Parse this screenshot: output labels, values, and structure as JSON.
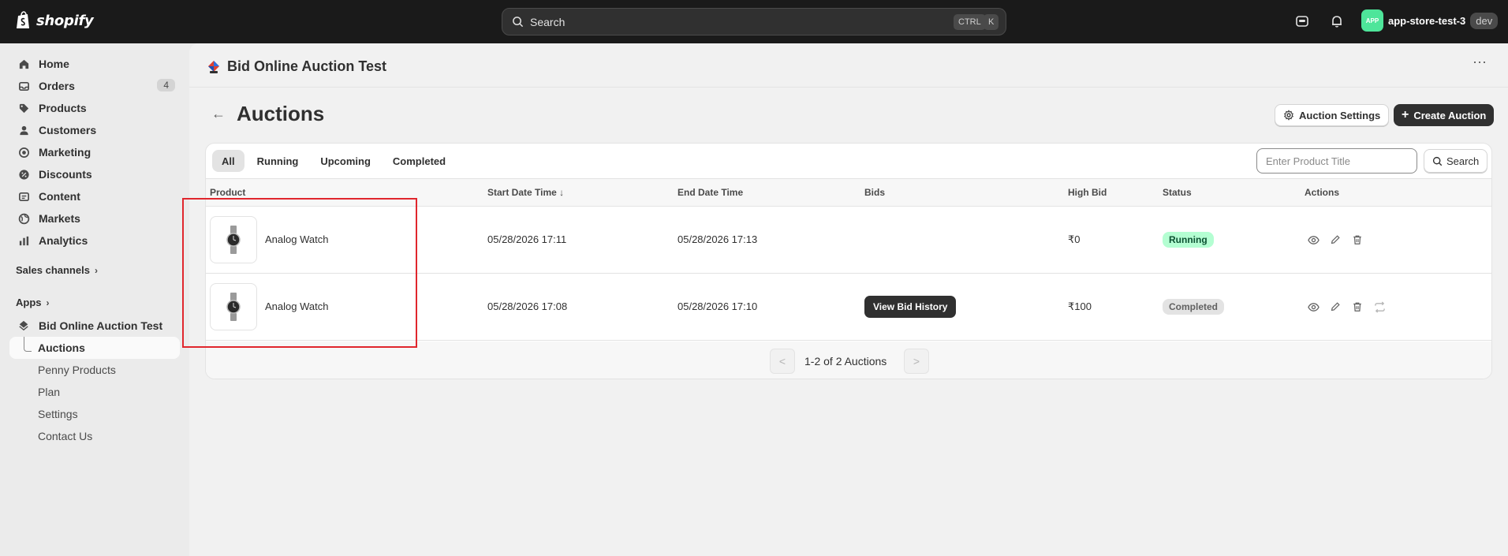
{
  "topbar": {
    "brand": "shopify",
    "search_placeholder": "Search",
    "kbd_ctrl": "CTRL",
    "kbd_k": "K",
    "store_avatar": "APP",
    "store_name": "app-store-test-3",
    "store_badge": "dev"
  },
  "sidebar": {
    "items": [
      {
        "label": "Home",
        "icon": "home-icon"
      },
      {
        "label": "Orders",
        "icon": "inbox-icon",
        "badge": "4"
      },
      {
        "label": "Products",
        "icon": "tag-icon"
      },
      {
        "label": "Customers",
        "icon": "person-icon"
      },
      {
        "label": "Marketing",
        "icon": "target-icon"
      },
      {
        "label": "Discounts",
        "icon": "discount-icon"
      },
      {
        "label": "Content",
        "icon": "content-icon"
      },
      {
        "label": "Markets",
        "icon": "globe-icon"
      },
      {
        "label": "Analytics",
        "icon": "bar-chart-icon"
      }
    ],
    "sales_channels": "Sales channels",
    "apps": "Apps",
    "app_name": "Bid Online Auction Test",
    "app_subitems": [
      "Auctions",
      "Penny Products",
      "Plan",
      "Settings",
      "Contact Us"
    ]
  },
  "header": {
    "app_title": "Bid Online Auction Test",
    "more": "⋯"
  },
  "page": {
    "title": "Auctions",
    "settings_button": "Auction Settings",
    "create_button": "Create Auction"
  },
  "tabs": [
    "All",
    "Running",
    "Upcoming",
    "Completed"
  ],
  "filter": {
    "placeholder": "Enter Product Title",
    "button": "Search"
  },
  "table": {
    "headers": [
      "Product",
      "Start Date Time",
      "End Date Time",
      "Bids",
      "High Bid",
      "Status",
      "Actions"
    ],
    "sort_indicator": "↓",
    "rows": [
      {
        "product": "Analog Watch",
        "start": "05/28/2026 17:11",
        "end": "05/28/2026 17:13",
        "bids": "",
        "high_bid": "₹0",
        "status": "Running"
      },
      {
        "product": "Analog Watch",
        "start": "05/28/2026 17:08",
        "end": "05/28/2026 17:10",
        "bids": "View Bid History",
        "high_bid": "₹100",
        "status": "Completed"
      }
    ]
  },
  "pagination": {
    "prev": "<",
    "next": ">",
    "summary": "1-2 of 2 Auctions"
  },
  "colors": {
    "topbar": "#1a1a1a",
    "running_badge": "#b4fed2",
    "highlight_box": "#e0262d"
  }
}
